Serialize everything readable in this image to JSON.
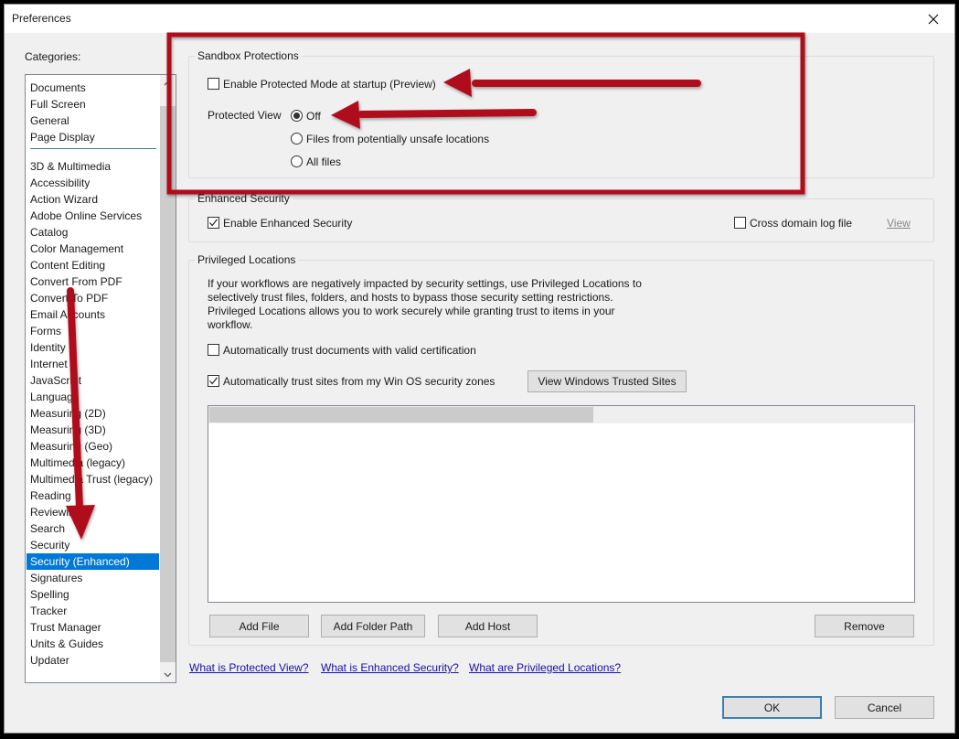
{
  "window": {
    "title": "Preferences",
    "close_icon": "close-icon"
  },
  "categories": {
    "label": "Categories:",
    "group1": [
      "Documents",
      "Full Screen",
      "General",
      "Page Display"
    ],
    "group2": [
      "3D & Multimedia",
      "Accessibility",
      "Action Wizard",
      "Adobe Online Services",
      "Catalog",
      "Color Management",
      "Content Editing",
      "Convert From PDF",
      "Convert To PDF",
      "Email Accounts",
      "Forms",
      "Identity",
      "Internet",
      "JavaScript",
      "Language",
      "Measuring (2D)",
      "Measuring (3D)",
      "Measuring (Geo)",
      "Multimedia (legacy)",
      "Multimedia Trust (legacy)",
      "Reading",
      "Reviewing",
      "Search",
      "Security",
      "Security (Enhanced)",
      "Signatures",
      "Spelling",
      "Tracker",
      "Trust Manager",
      "Units & Guides",
      "Updater"
    ],
    "selected": "Security (Enhanced)"
  },
  "sandbox": {
    "title": "Sandbox Protections",
    "protected_mode_label": "Enable Protected Mode at startup (Preview)",
    "protected_mode_checked": false,
    "protected_view_label": "Protected View",
    "options": [
      {
        "label": "Off",
        "selected": true
      },
      {
        "label": "Files from potentially unsafe locations",
        "selected": false
      },
      {
        "label": "All files",
        "selected": false
      }
    ]
  },
  "enhanced": {
    "title": "Enhanced Security",
    "enable_label": "Enable Enhanced Security",
    "enable_checked": true,
    "cross_domain_label": "Cross domain log file",
    "cross_domain_checked": false,
    "view_link": "View"
  },
  "privileged": {
    "title": "Privileged Locations",
    "description": "If your workflows are negatively impacted by security settings, use Privileged Locations to selectively trust files, folders, and hosts to bypass those security setting restrictions. Privileged Locations allows you to work securely while granting trust to items in your workflow.",
    "trust_cert_label": "Automatically trust documents with valid certification",
    "trust_cert_checked": false,
    "trust_sites_label": "Automatically trust sites from my Win OS security zones",
    "trust_sites_checked": true,
    "view_trusted_sites": "View Windows Trusted Sites",
    "add_file": "Add File",
    "add_folder": "Add Folder Path",
    "add_host": "Add Host",
    "remove": "Remove"
  },
  "links": {
    "protected_view": "What is Protected View?",
    "enhanced_security": "What is Enhanced Security?",
    "privileged_locations": "What are Privileged Locations?"
  },
  "footer": {
    "ok": "OK",
    "cancel": "Cancel"
  },
  "annotation": {
    "color": "#b0101c"
  }
}
